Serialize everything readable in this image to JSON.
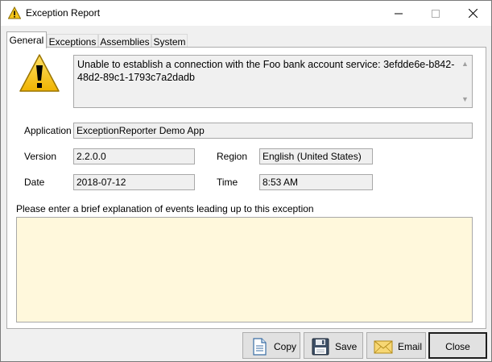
{
  "window": {
    "title": "Exception Report",
    "title_icon": "warning-icon",
    "controls": [
      "minimize-icon",
      "maximize-icon",
      "close-icon"
    ]
  },
  "tabs": [
    {
      "label": "General",
      "active": true
    },
    {
      "label": "Exceptions",
      "active": false
    },
    {
      "label": "Assemblies",
      "active": false
    },
    {
      "label": "System",
      "active": false
    }
  ],
  "general": {
    "message": "Unable to establish a connection with the Foo bank account service: 3efdde6e-b842-48d2-89c1-1793c7a2dadb",
    "application_label": "Application",
    "application_value": "ExceptionReporter Demo App",
    "version_label": "Version",
    "version_value": "2.2.0.0",
    "region_label": "Region",
    "region_value": "English (United States)",
    "date_label": "Date",
    "date_value": "2018-07-12",
    "time_label": "Time",
    "time_value": "8:53 AM",
    "explanation_prompt": "Please enter a brief explanation of events leading up to this exception",
    "explanation_value": ""
  },
  "buttons": {
    "copy": "Copy",
    "save": "Save",
    "email": "Email",
    "close": "Close"
  },
  "colors": {
    "explanation_bg": "#fff8dc",
    "readonly_bg": "#f0f0f0",
    "warning_yellow": "#f5c518"
  }
}
